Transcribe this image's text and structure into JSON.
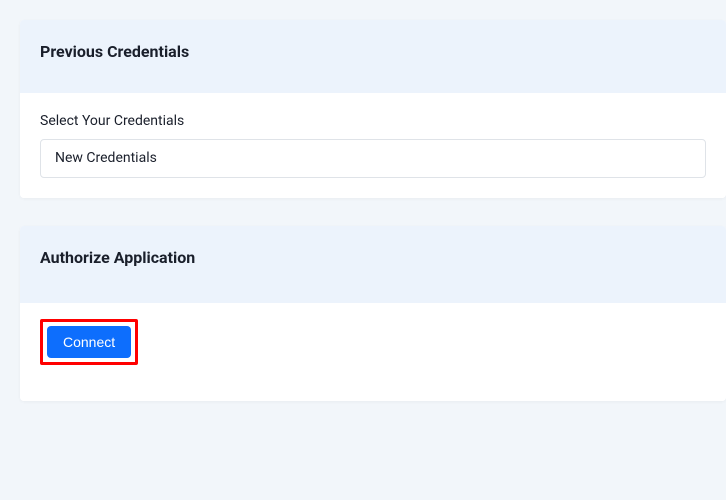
{
  "cards": {
    "previous_credentials": {
      "title": "Previous Credentials",
      "label": "Select Your Credentials",
      "selected_option": "New Credentials"
    },
    "authorize": {
      "title": "Authorize Application",
      "button_label": "Connect"
    }
  }
}
